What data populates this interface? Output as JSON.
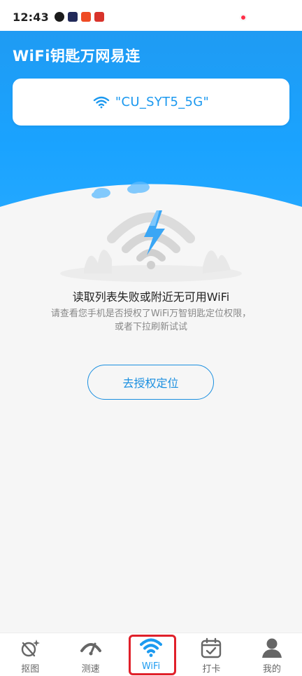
{
  "status_bar": {
    "time": "12:43",
    "icons": [
      {
        "name": "app-notification-icon-1",
        "color": "#1b1b1b"
      },
      {
        "name": "app-notification-icon-2",
        "color": "#222a5a"
      },
      {
        "name": "app-notification-icon-3",
        "color": "#ef4b25"
      },
      {
        "name": "app-notification-icon-4",
        "color": "#d8332b"
      }
    ],
    "dot_color": "#ff2e48"
  },
  "header": {
    "title": "WiFi钥匙万网易连",
    "current_wifi": "\"CU_SYT5_5G\""
  },
  "message": {
    "title": "读取列表失败或附近无可用WiFi",
    "description_line1": "请查看您手机是否授权了WiFi万智钥匙定位权限，",
    "description_line2": "或者下拉刷新试试"
  },
  "auth_button": {
    "label": "去授权定位"
  },
  "bottom_nav": {
    "items": [
      {
        "label": "抠图",
        "icon": "cutout-icon",
        "active": false
      },
      {
        "label": "测速",
        "icon": "speedometer-icon",
        "active": false
      },
      {
        "label": "WiFi",
        "icon": "wifi-icon",
        "active": true
      },
      {
        "label": "打卡",
        "icon": "calendar-check-icon",
        "active": false
      },
      {
        "label": "我的",
        "icon": "user-icon",
        "active": false
      }
    ]
  },
  "colors": {
    "brand_blue": "#1aa3ff",
    "active_nav": "#1d9bf0",
    "button_border": "#1a8fe0",
    "highlight_red": "#e0202a"
  }
}
